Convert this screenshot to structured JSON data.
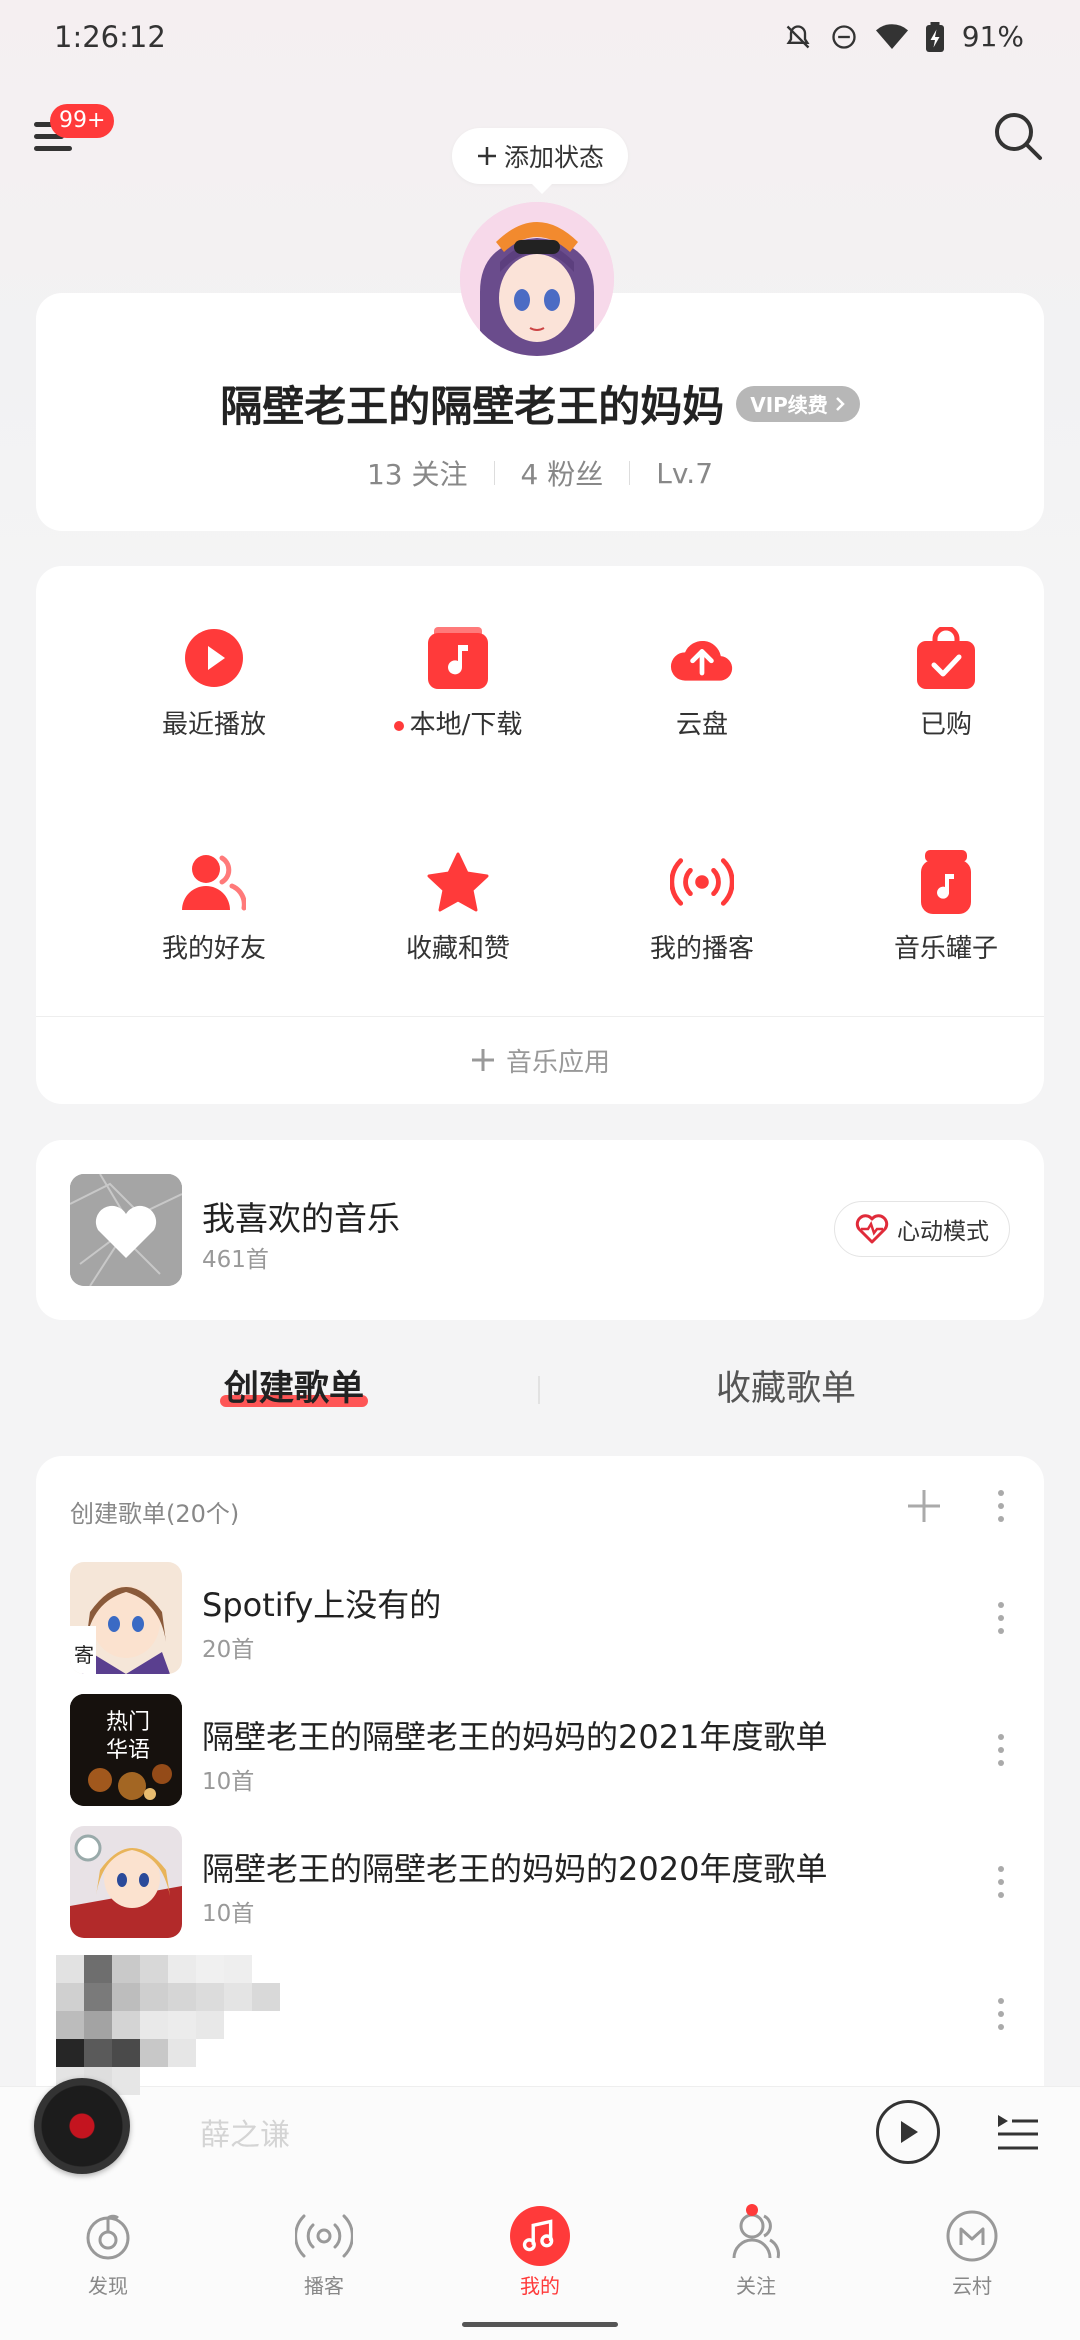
{
  "status_bar": {
    "time": "1:26:12",
    "battery": "91%"
  },
  "topbar": {
    "menu_badge": "99+",
    "add_status_label": "添加状态"
  },
  "profile": {
    "name": "隔壁老王的隔壁老王的妈妈",
    "vip_label": "VIP续费",
    "follow_count": "13",
    "follow_label": "关注",
    "fans_count": "4",
    "fans_label": "粉丝",
    "level": "Lv.7"
  },
  "grid": {
    "items": [
      {
        "label": "最近播放",
        "icon": "play-circle-icon"
      },
      {
        "label": "本地/下载",
        "icon": "music-folder-icon",
        "dot": true
      },
      {
        "label": "云盘",
        "icon": "cloud-upload-icon"
      },
      {
        "label": "已购",
        "icon": "shopping-bag-icon"
      },
      {
        "label": "我的好友",
        "icon": "friends-icon"
      },
      {
        "label": "收藏和赞",
        "icon": "star-icon"
      },
      {
        "label": "我的播客",
        "icon": "podcast-icon"
      },
      {
        "label": "音乐罐子",
        "icon": "music-jar-icon"
      }
    ],
    "music_apps_label": "音乐应用"
  },
  "liked": {
    "title": "我喜欢的音乐",
    "count": "461首",
    "heart_mode_label": "心动模式"
  },
  "tabs": {
    "created": "创建歌单",
    "collected": "收藏歌单"
  },
  "playlists": {
    "header": "创建歌单(20个)",
    "items": [
      {
        "title": "Spotify上没有的",
        "count": "20首"
      },
      {
        "title": "隔壁老王的隔壁老王的妈妈的2021年度歌单",
        "count": "10首",
        "cover_text_1": "热门",
        "cover_text_2": "华语"
      },
      {
        "title": "隔壁老王的隔壁老王的妈妈的2020年度歌单",
        "count": "10首"
      }
    ]
  },
  "mini_player": {
    "title": "薛之谦"
  },
  "bottom_nav": {
    "items": [
      {
        "label": "发现"
      },
      {
        "label": "播客"
      },
      {
        "label": "我的"
      },
      {
        "label": "关注"
      },
      {
        "label": "云村"
      }
    ]
  },
  "colors": {
    "accent": "#ff3a3a",
    "background": "#f4f4f5",
    "card": "#ffffff"
  }
}
